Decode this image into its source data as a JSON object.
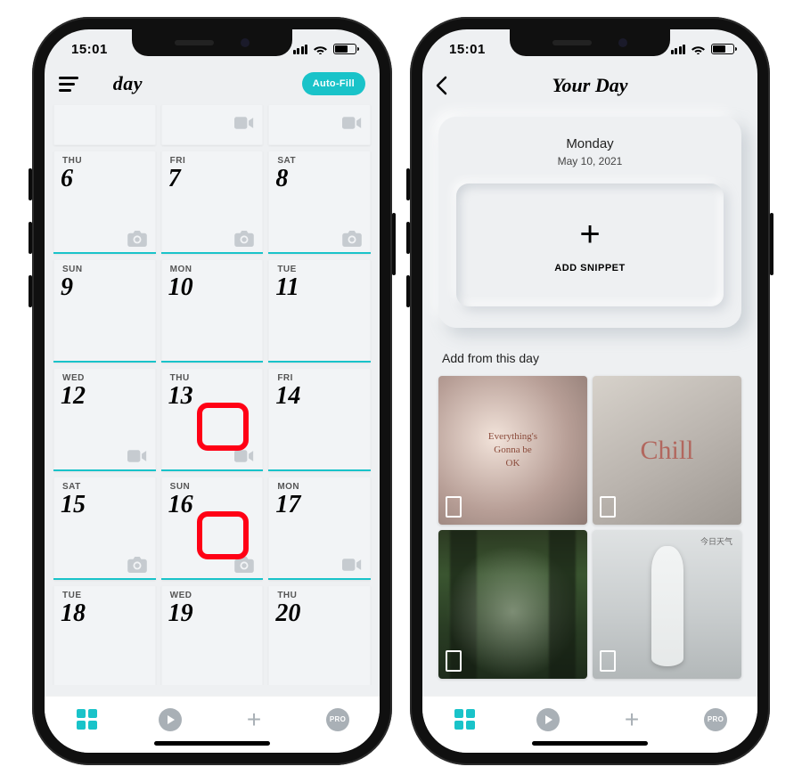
{
  "status": {
    "time": "15:01"
  },
  "left": {
    "brand": "day",
    "autofill": "Auto-Fill",
    "rows": [
      [
        {
          "half": true,
          "icon": null
        },
        {
          "half": true,
          "icon": "video"
        },
        {
          "half": true,
          "icon": "video"
        }
      ],
      [
        {
          "dow": "THU",
          "num": "6",
          "icon": "camera",
          "teal": true
        },
        {
          "dow": "FRI",
          "num": "7",
          "icon": "camera",
          "teal": true
        },
        {
          "dow": "SAT",
          "num": "8",
          "icon": "camera",
          "teal": true
        }
      ],
      [
        {
          "dow": "SUN",
          "num": "9",
          "icon": null,
          "teal": true
        },
        {
          "dow": "MON",
          "num": "10",
          "icon": null,
          "teal": true
        },
        {
          "dow": "TUE",
          "num": "11",
          "icon": null,
          "teal": true
        }
      ],
      [
        {
          "dow": "WED",
          "num": "12",
          "icon": "video",
          "teal": true
        },
        {
          "dow": "THU",
          "num": "13",
          "icon": "video",
          "teal": true
        },
        {
          "dow": "FRI",
          "num": "14",
          "icon": null,
          "teal": true
        }
      ],
      [
        {
          "dow": "SAT",
          "num": "15",
          "icon": "camera",
          "teal": true
        },
        {
          "dow": "SUN",
          "num": "16",
          "icon": "camera",
          "teal": true
        },
        {
          "dow": "MON",
          "num": "17",
          "icon": "video",
          "teal": true
        }
      ],
      [
        {
          "dow": "TUE",
          "num": "18",
          "icon": null,
          "teal": false
        },
        {
          "dow": "WED",
          "num": "19",
          "icon": null,
          "teal": false
        },
        {
          "dow": "THU",
          "num": "20",
          "icon": null,
          "teal": false
        }
      ]
    ]
  },
  "right": {
    "title": "Your Day",
    "weekday": "Monday",
    "fulldate": "May 10, 2021",
    "add_snippet": "ADD SNIPPET",
    "section": "Add from this day",
    "thumbs": {
      "t1_quote": "Everything's\nGonna be\nOK",
      "t2_text": "Chill",
      "t4_caption": "今日天气"
    }
  },
  "tabbar": {
    "pro": "PRO"
  }
}
